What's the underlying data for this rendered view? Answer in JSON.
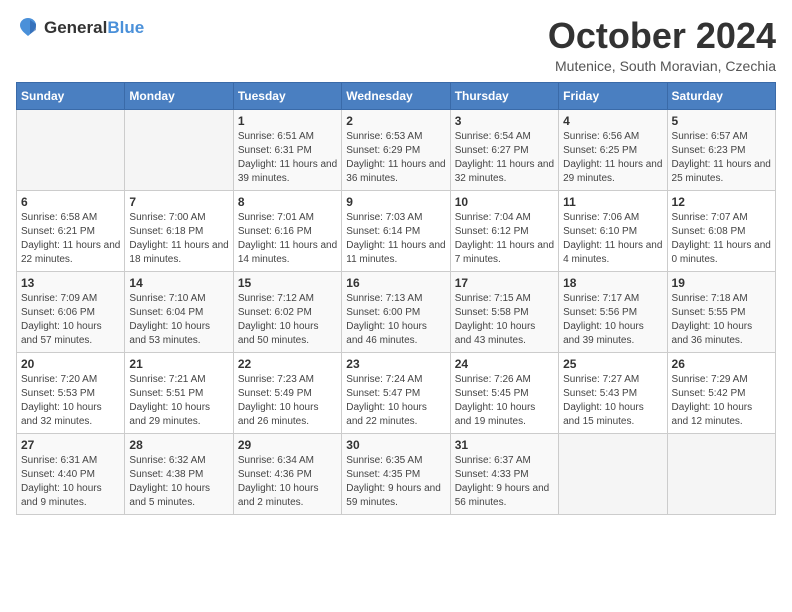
{
  "logo": {
    "general": "General",
    "blue": "Blue"
  },
  "title": "October 2024",
  "subtitle": "Mutenice, South Moravian, Czechia",
  "days_of_week": [
    "Sunday",
    "Monday",
    "Tuesday",
    "Wednesday",
    "Thursday",
    "Friday",
    "Saturday"
  ],
  "weeks": [
    [
      {
        "day": "",
        "info": ""
      },
      {
        "day": "",
        "info": ""
      },
      {
        "day": "1",
        "info": "Sunrise: 6:51 AM\nSunset: 6:31 PM\nDaylight: 11 hours and 39 minutes."
      },
      {
        "day": "2",
        "info": "Sunrise: 6:53 AM\nSunset: 6:29 PM\nDaylight: 11 hours and 36 minutes."
      },
      {
        "day": "3",
        "info": "Sunrise: 6:54 AM\nSunset: 6:27 PM\nDaylight: 11 hours and 32 minutes."
      },
      {
        "day": "4",
        "info": "Sunrise: 6:56 AM\nSunset: 6:25 PM\nDaylight: 11 hours and 29 minutes."
      },
      {
        "day": "5",
        "info": "Sunrise: 6:57 AM\nSunset: 6:23 PM\nDaylight: 11 hours and 25 minutes."
      }
    ],
    [
      {
        "day": "6",
        "info": "Sunrise: 6:58 AM\nSunset: 6:21 PM\nDaylight: 11 hours and 22 minutes."
      },
      {
        "day": "7",
        "info": "Sunrise: 7:00 AM\nSunset: 6:18 PM\nDaylight: 11 hours and 18 minutes."
      },
      {
        "day": "8",
        "info": "Sunrise: 7:01 AM\nSunset: 6:16 PM\nDaylight: 11 hours and 14 minutes."
      },
      {
        "day": "9",
        "info": "Sunrise: 7:03 AM\nSunset: 6:14 PM\nDaylight: 11 hours and 11 minutes."
      },
      {
        "day": "10",
        "info": "Sunrise: 7:04 AM\nSunset: 6:12 PM\nDaylight: 11 hours and 7 minutes."
      },
      {
        "day": "11",
        "info": "Sunrise: 7:06 AM\nSunset: 6:10 PM\nDaylight: 11 hours and 4 minutes."
      },
      {
        "day": "12",
        "info": "Sunrise: 7:07 AM\nSunset: 6:08 PM\nDaylight: 11 hours and 0 minutes."
      }
    ],
    [
      {
        "day": "13",
        "info": "Sunrise: 7:09 AM\nSunset: 6:06 PM\nDaylight: 10 hours and 57 minutes."
      },
      {
        "day": "14",
        "info": "Sunrise: 7:10 AM\nSunset: 6:04 PM\nDaylight: 10 hours and 53 minutes."
      },
      {
        "day": "15",
        "info": "Sunrise: 7:12 AM\nSunset: 6:02 PM\nDaylight: 10 hours and 50 minutes."
      },
      {
        "day": "16",
        "info": "Sunrise: 7:13 AM\nSunset: 6:00 PM\nDaylight: 10 hours and 46 minutes."
      },
      {
        "day": "17",
        "info": "Sunrise: 7:15 AM\nSunset: 5:58 PM\nDaylight: 10 hours and 43 minutes."
      },
      {
        "day": "18",
        "info": "Sunrise: 7:17 AM\nSunset: 5:56 PM\nDaylight: 10 hours and 39 minutes."
      },
      {
        "day": "19",
        "info": "Sunrise: 7:18 AM\nSunset: 5:55 PM\nDaylight: 10 hours and 36 minutes."
      }
    ],
    [
      {
        "day": "20",
        "info": "Sunrise: 7:20 AM\nSunset: 5:53 PM\nDaylight: 10 hours and 32 minutes."
      },
      {
        "day": "21",
        "info": "Sunrise: 7:21 AM\nSunset: 5:51 PM\nDaylight: 10 hours and 29 minutes."
      },
      {
        "day": "22",
        "info": "Sunrise: 7:23 AM\nSunset: 5:49 PM\nDaylight: 10 hours and 26 minutes."
      },
      {
        "day": "23",
        "info": "Sunrise: 7:24 AM\nSunset: 5:47 PM\nDaylight: 10 hours and 22 minutes."
      },
      {
        "day": "24",
        "info": "Sunrise: 7:26 AM\nSunset: 5:45 PM\nDaylight: 10 hours and 19 minutes."
      },
      {
        "day": "25",
        "info": "Sunrise: 7:27 AM\nSunset: 5:43 PM\nDaylight: 10 hours and 15 minutes."
      },
      {
        "day": "26",
        "info": "Sunrise: 7:29 AM\nSunset: 5:42 PM\nDaylight: 10 hours and 12 minutes."
      }
    ],
    [
      {
        "day": "27",
        "info": "Sunrise: 6:31 AM\nSunset: 4:40 PM\nDaylight: 10 hours and 9 minutes."
      },
      {
        "day": "28",
        "info": "Sunrise: 6:32 AM\nSunset: 4:38 PM\nDaylight: 10 hours and 5 minutes."
      },
      {
        "day": "29",
        "info": "Sunrise: 6:34 AM\nSunset: 4:36 PM\nDaylight: 10 hours and 2 minutes."
      },
      {
        "day": "30",
        "info": "Sunrise: 6:35 AM\nSunset: 4:35 PM\nDaylight: 9 hours and 59 minutes."
      },
      {
        "day": "31",
        "info": "Sunrise: 6:37 AM\nSunset: 4:33 PM\nDaylight: 9 hours and 56 minutes."
      },
      {
        "day": "",
        "info": ""
      },
      {
        "day": "",
        "info": ""
      }
    ]
  ]
}
